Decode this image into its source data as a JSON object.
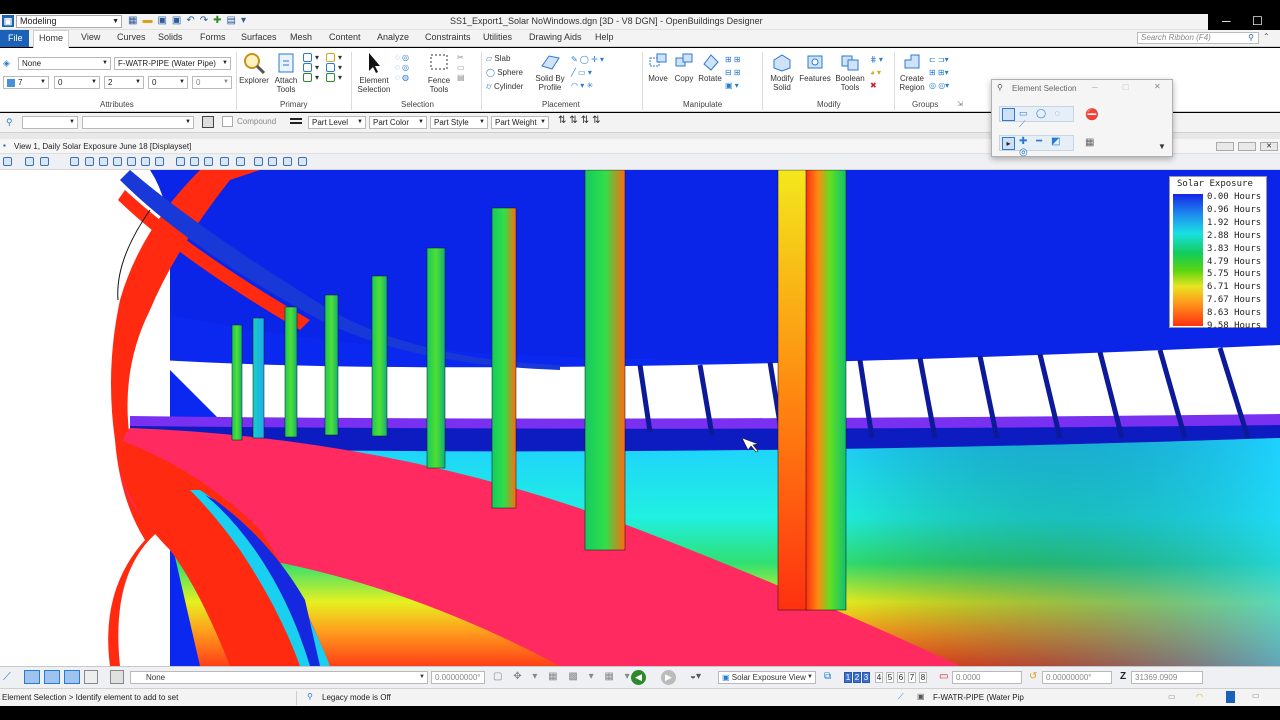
{
  "window": {
    "workflow": "Modeling",
    "title": "SS1_Export1_Solar NoWindows.dgn [3D - V8 DGN] - OpenBuildings Designer",
    "minimize": "─",
    "maximize": "☐"
  },
  "tabs": [
    "File",
    "Home",
    "View",
    "Curves",
    "Solids",
    "Forms",
    "Surfaces",
    "Mesh",
    "Content",
    "Analyze",
    "Constraints",
    "Utilities",
    "Drawing Aids",
    "Help"
  ],
  "search": {
    "placeholder": "Search Ribbon (F4)"
  },
  "ribbon": {
    "attributes": {
      "level": "None",
      "style": "F-WATR-PIPE (Water Pipe)",
      "color": "7",
      "weight_a": "0",
      "weight_b": "0",
      "line_style": "2",
      "transparency": "0",
      "priority": "0",
      "label": "Attributes"
    },
    "primary": {
      "explorer": "Explorer",
      "attach": "Attach Tools",
      "label": "Primary"
    },
    "selection": {
      "element": "Element Selection",
      "fence": "Fence Tools",
      "label": "Selection"
    },
    "placement": {
      "slab": "Slab",
      "sphere": "Sphere",
      "cylinder": "Cylinder",
      "solid_by_profile": "Solid By Profile",
      "label": "Placement"
    },
    "manipulate": {
      "move": "Move",
      "copy": "Copy",
      "rotate": "Rotate",
      "label": "Manipulate"
    },
    "modify": {
      "modify_solid": "Modify Solid",
      "features": "Features",
      "boolean": "Boolean Tools",
      "label": "Modify"
    },
    "groups": {
      "create_region": "Create Region",
      "label": "Groups"
    }
  },
  "attrbar": {
    "compound": "Compound",
    "part_level": "Part Level",
    "part_color": "Part Color",
    "part_style": "Part Style",
    "part_weight": "Part Weight"
  },
  "element_selection": {
    "title": "Element Selection"
  },
  "view": {
    "title": "View 1, Daily Solar Exposure June 18 [Displayset]"
  },
  "legend": {
    "title": "Solar Exposure",
    "entries": [
      "0.00 Hours",
      "0.96 Hours",
      "1.92 Hours",
      "2.88 Hours",
      "3.83 Hours",
      "4.79 Hours",
      "5.75 Hours",
      "6.71 Hours",
      "7.67 Hours",
      "8.63 Hours",
      "9.58 Hours"
    ]
  },
  "status": {
    "level": "None",
    "angle": "0.00000000°",
    "view_name": "Solar Exposure View",
    "views": [
      "1",
      "2",
      "3",
      "4",
      "5",
      "6",
      "7",
      "8"
    ],
    "dist": "0.0000",
    "rot": "0.00000000°",
    "z_label": "Z",
    "z": "31369.0909"
  },
  "message": {
    "prompt": "Element Selection > Identify element to add to set",
    "legacy": "Legacy mode is Off",
    "active_element": "F-WATR-PIPE (Water Pip"
  },
  "colors": {
    "brand": "#1a62b7",
    "sky": "#0a28f0",
    "hot": "#ff3010",
    "pipe": "#ff2d55"
  }
}
